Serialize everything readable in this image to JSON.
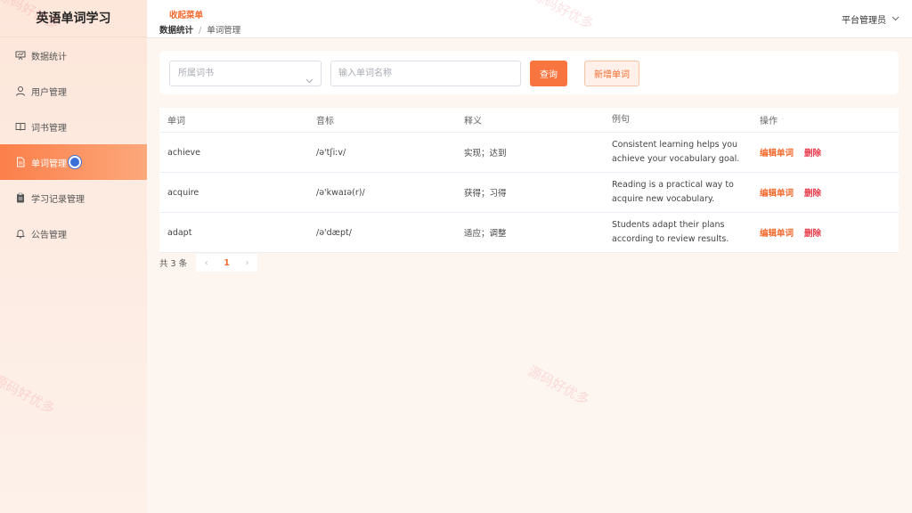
{
  "app": {
    "title": "英语单词学习"
  },
  "sidebar": {
    "items": [
      {
        "label": "数据统计",
        "icon": "presentation-icon"
      },
      {
        "label": "用户管理",
        "icon": "user-icon"
      },
      {
        "label": "词书管理",
        "icon": "book-icon"
      },
      {
        "label": "单词管理",
        "icon": "document-icon",
        "active": true
      },
      {
        "label": "学习记录管理",
        "icon": "clipboard-icon"
      },
      {
        "label": "公告管理",
        "icon": "bell-icon"
      }
    ]
  },
  "header": {
    "collapse_label": "收起菜单",
    "breadcrumb": {
      "home": "数据统计",
      "separator": "/",
      "current": "单词管理"
    },
    "user": "平台管理员"
  },
  "filter": {
    "book_select_placeholder": "所属词书",
    "word_input_placeholder": "输入单词名称",
    "query_label": "查询",
    "add_label": "新增单词"
  },
  "table": {
    "headers": [
      "单词",
      "音标",
      "释义",
      "例句",
      "操作"
    ],
    "rows": [
      {
        "word": "achieve",
        "phonetic": "/ə'tʃiːv/",
        "meaning": "实现；达到",
        "example": "Consistent learning helps you achieve your vocabulary goal.",
        "edit": "编辑单词",
        "delete": "删除"
      },
      {
        "word": "acquire",
        "phonetic": "/ə'kwaɪə(r)/",
        "meaning": "获得；习得",
        "example": "Reading is a practical way to acquire new vocabulary.",
        "edit": "编辑单词",
        "delete": "删除"
      },
      {
        "word": "adapt",
        "phonetic": "/ə'dæpt/",
        "meaning": "适应；调整",
        "example": "Students adapt their plans according to review results.",
        "edit": "编辑单词",
        "delete": "删除"
      }
    ]
  },
  "pagination": {
    "total_text": "共 3 条",
    "prev": "‹",
    "current_page": "1",
    "next": "›"
  },
  "watermark": {
    "text": "源码好优多"
  },
  "colors": {
    "accent": "#f9753f",
    "danger": "#e8394a",
    "sidebar_active": "#fb7f4a"
  }
}
